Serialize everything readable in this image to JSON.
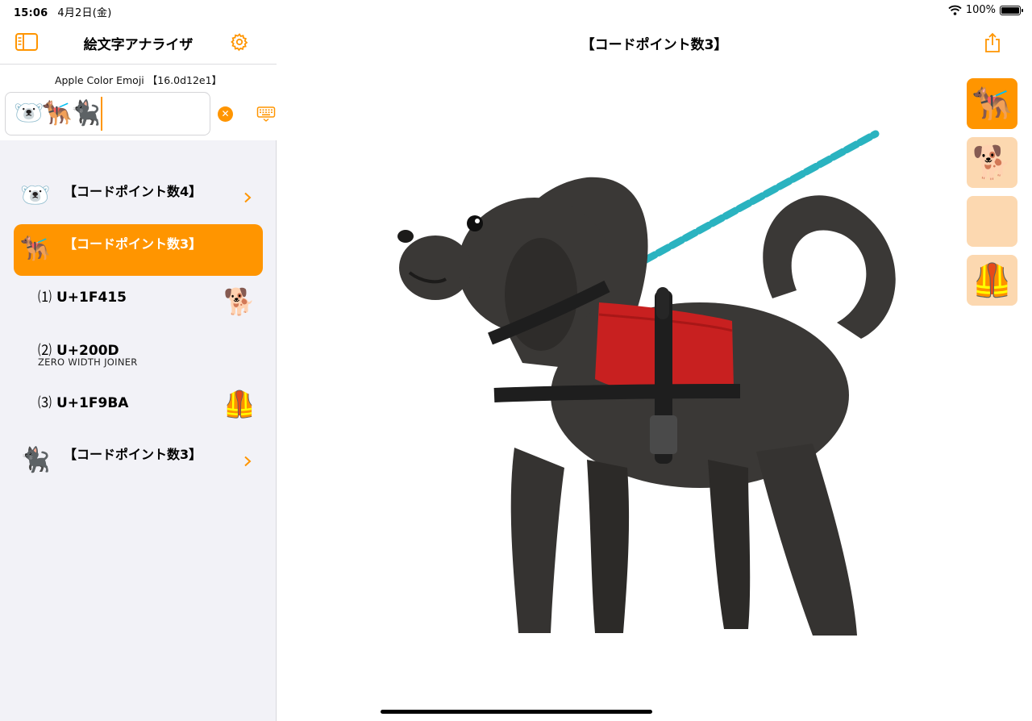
{
  "status": {
    "time": "15:06",
    "date": "4月2日(金)",
    "battery": "100%"
  },
  "sidebar": {
    "title": "絵文字アナライザ",
    "font_info": "Apple Color Emoji 【16.0d12e1】",
    "input_value": "🐻‍❄️🐕‍🦺🐈‍⬛",
    "icons": {
      "sidebar_toggle": "sidebar-icon",
      "settings": "gear-icon",
      "clear": "clear-icon",
      "keyboard": "keyboard-icon"
    },
    "clear_glyph": "✕",
    "items": [
      {
        "emoji": "🐻‍❄️",
        "title": "【コードポイント数4】"
      },
      {
        "emoji": "🐕‍🦺",
        "title": "【コードポイント数3】"
      },
      {
        "emoji": "🐈‍⬛",
        "title": "【コードポイント数3】"
      }
    ],
    "codepoints": [
      {
        "index": "⑴",
        "code": "U+1F415",
        "name": "",
        "emoji": "🐕"
      },
      {
        "index": "⑵",
        "code": "U+200D",
        "name": "ZERO WIDTH JOINER",
        "emoji": ""
      },
      {
        "index": "⑶",
        "code": "U+1F9BA",
        "name": "",
        "emoji": "🦺"
      }
    ]
  },
  "detail": {
    "title": "【コードポイント数3】",
    "variants": [
      "🐕‍🦺",
      "🐕",
      "",
      "🦺"
    ]
  },
  "colors": {
    "accent": "#ff9500",
    "variant_bg": "#fcd8b0",
    "sidebar_bg": "#f2f2f7"
  }
}
